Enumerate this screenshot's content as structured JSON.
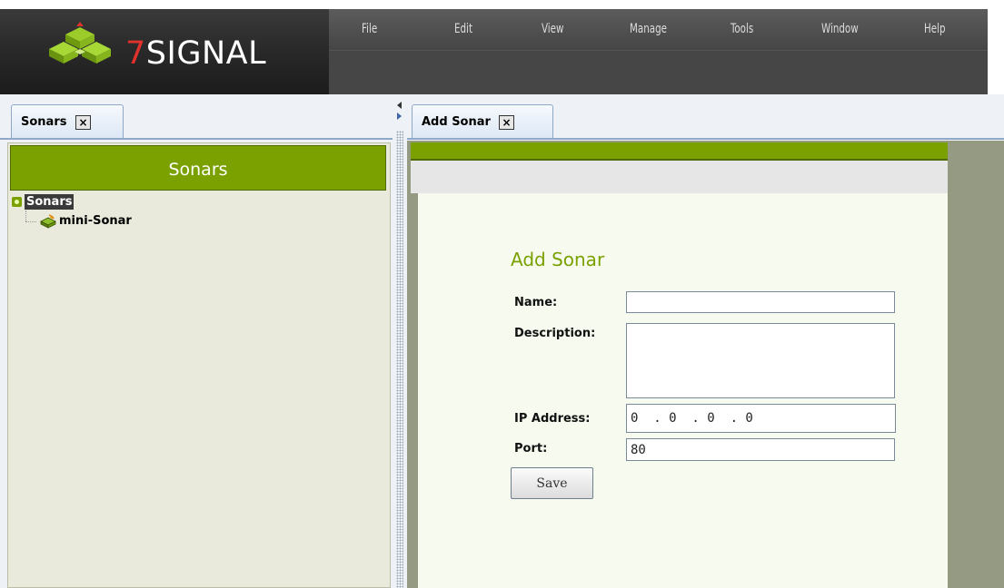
{
  "brand": {
    "seven": "7",
    "name": "SIGNAL"
  },
  "menu": [
    "File",
    "Edit",
    "View",
    "Manage",
    "Tools",
    "Window",
    "Help"
  ],
  "left_panel": {
    "tab_label": "Sonars",
    "tab_close": "×",
    "header_title": "Sonars",
    "tree": {
      "root_label": "Sonars",
      "children": [
        "mini-Sonar"
      ]
    }
  },
  "right_panel": {
    "tab_label": "Add Sonar",
    "tab_close": "×",
    "form": {
      "title": "Add Sonar",
      "name_label": "Name:",
      "name_value": "",
      "description_label": "Description:",
      "description_value": "",
      "ip_label": "IP Address:",
      "ip_value": "0  . 0  . 0  . 0",
      "port_label": "Port:",
      "port_value": "80",
      "save_label": "Save"
    }
  },
  "colors": {
    "accent_green": "#7aa100",
    "brand_red": "#e0322c",
    "header_dark": "#2a2a2a"
  }
}
